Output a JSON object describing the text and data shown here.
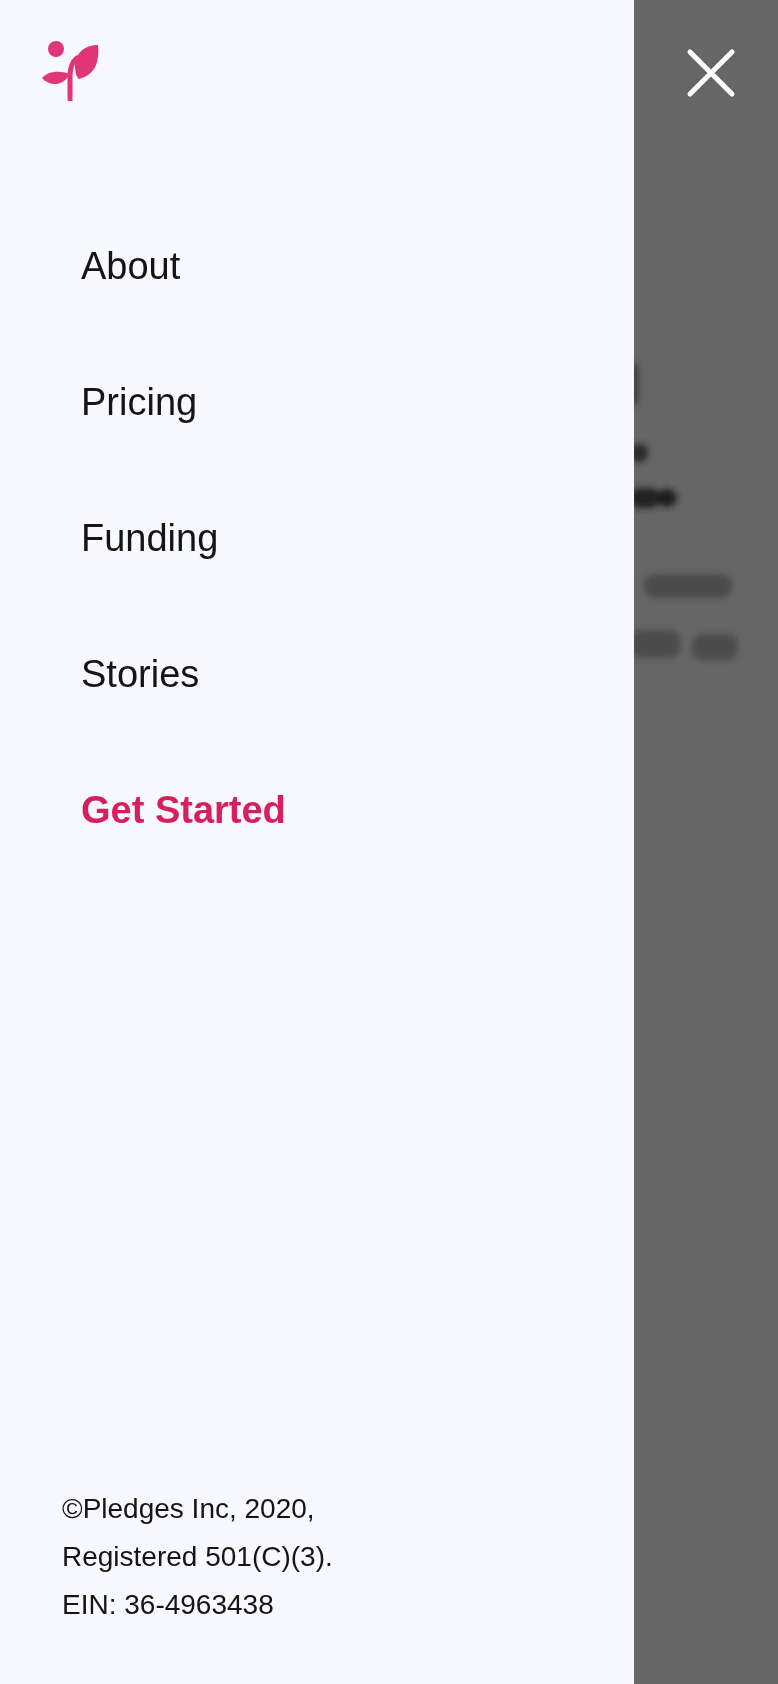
{
  "drawer": {
    "menu_items": [
      {
        "label": "About",
        "kind": "link"
      },
      {
        "label": "Pricing",
        "kind": "link"
      },
      {
        "label": "Funding",
        "kind": "link"
      },
      {
        "label": "Stories",
        "kind": "link"
      },
      {
        "label": "Get Started",
        "kind": "cta"
      }
    ],
    "footer": {
      "lines": [
        "©Pledges Inc, 2020,",
        "Registered 501(C)(3).",
        "EIN: 36-4963438"
      ]
    }
  }
}
